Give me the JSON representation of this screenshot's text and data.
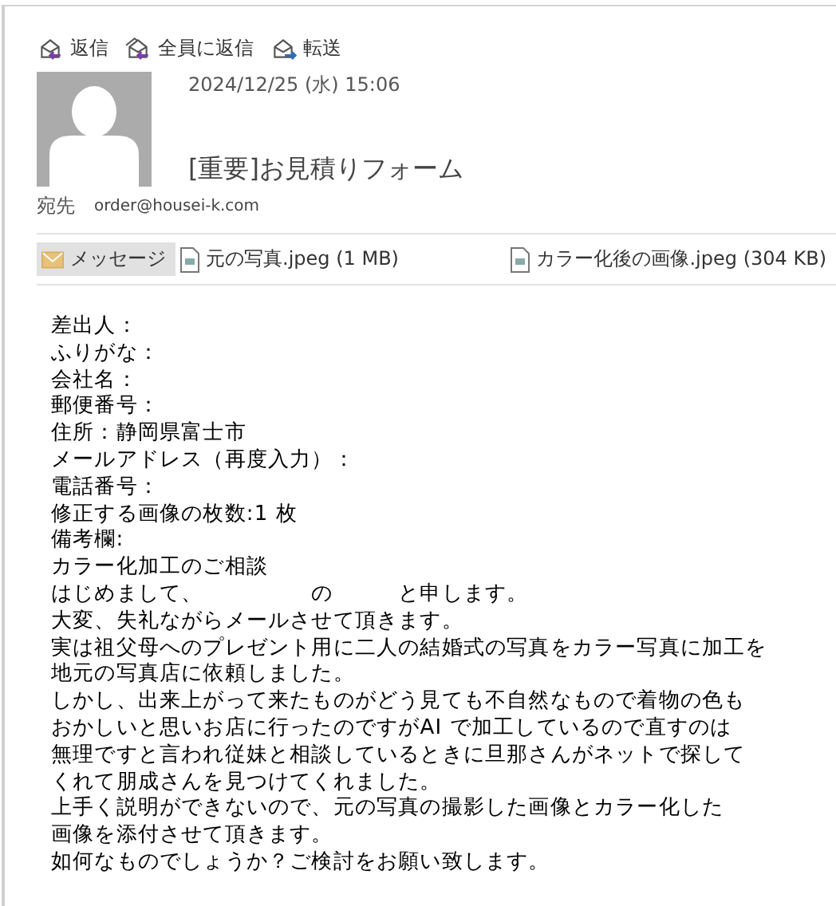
{
  "toolbar": [
    {
      "label": "返信",
      "kind": "reply"
    },
    {
      "label": "全員に返信",
      "kind": "reply_all"
    },
    {
      "label": "転送",
      "kind": "forward"
    }
  ],
  "header": {
    "date": "2024/12/25 (水) 15:06",
    "subject": "[重要]お見積りフォーム",
    "to_label": "宛先",
    "to": "order@housei-k.com"
  },
  "attachments": [
    {
      "kind": "message",
      "label": "メッセージ",
      "selected": true
    },
    {
      "kind": "file",
      "label": "元の写真.jpeg (1 MB)",
      "selected": false
    },
    {
      "kind": "file",
      "label": "カラー化後の画像.jpeg (304 KB)",
      "selected": false
    }
  ],
  "body": [
    "差出人：",
    "ふりがな：",
    "会社名：",
    "郵便番号：",
    "住所：静岡県富士市",
    "メールアドレス（再度入力）：",
    "電話番号：",
    "修正する画像の枚数:1 枚",
    "備考欄:",
    "カラー化加工のご相談",
    "はじめまして、　　　　　の　　　と申します。",
    "大変、失礼ながらメールさせて頂きます。",
    "実は祖父母へのプレゼント用に二人の結婚式の写真をカラー写真に加工を",
    "地元の写真店に依頼しました。",
    "しかし、出来上がって来たものがどう見ても不自然なもので着物の色も",
    "おかしいと思いお店に行ったのですがAI で加工しているので直すのは",
    "無理ですと言われ従妹と相談しているときに旦那さんがネットで探して",
    "くれて朋成さんを見つけてくれました。",
    "上手く説明ができないので、元の写真の撮影した画像とカラー化した",
    "画像を添付させて頂きます。",
    "如何なものでしょうか？ご検討をお願い致します。"
  ]
}
